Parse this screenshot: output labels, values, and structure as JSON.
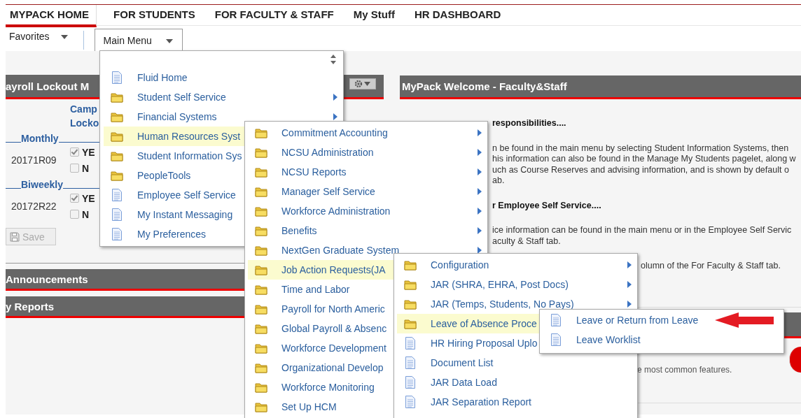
{
  "nav": {
    "tabs": [
      {
        "label": "MYPACK HOME",
        "selected": true
      },
      {
        "label": "FOR STUDENTS",
        "selected": false
      },
      {
        "label": "FOR FACULTY & STAFF",
        "selected": false
      },
      {
        "label": "My Stuff",
        "selected": false
      },
      {
        "label": "HR DASHBOARD",
        "selected": false
      }
    ]
  },
  "toolbar": {
    "favorites": "Favorites",
    "main_menu": "Main Menu"
  },
  "payroll_lockout": {
    "title": "ayroll Lockout M",
    "column_header": [
      "Camp",
      "Locko"
    ],
    "groups": [
      {
        "label": "Monthly",
        "period": "20171R09",
        "options": [
          {
            "label": "YE",
            "checked": true
          },
          {
            "label": "N",
            "checked": false
          }
        ]
      },
      {
        "label": "Biweekly",
        "period": "20172R22",
        "options": [
          {
            "label": "YE",
            "checked": true
          },
          {
            "label": "N",
            "checked": false
          }
        ]
      }
    ],
    "save_button": {
      "label": "Save",
      "disabled": true
    }
  },
  "left_pagelets": [
    {
      "title": "Announcements"
    },
    {
      "title": "y Reports"
    }
  ],
  "welcome": {
    "title": "MyPack Welcome - Faculty&Staff",
    "paragraphs": [
      {
        "kind": "heading",
        "lines": [
          "responsibilities...."
        ]
      },
      {
        "kind": "body",
        "lines": [
          "n be found in the main menu by selecting Student Information Systems, then",
          "his information can also be found in the Manage My Students pagelet, along w",
          "uch as Course Reserves and advising information, and is shown by default o",
          "ab."
        ]
      },
      {
        "kind": "heading",
        "lines": [
          "r Employee Self Service...."
        ]
      },
      {
        "kind": "body",
        "lines": [
          "ice information can be found in the main menu or in the Employee Self Servic",
          "aculty & Staff tab."
        ]
      },
      {
        "kind": "note",
        "lines": [
          "olumn of the For Faculty & Staff tab."
        ]
      }
    ]
  },
  "lower_pagelet": {
    "text": "e most common features."
  },
  "menus": [
    {
      "items": [
        {
          "label": "Fluid Home",
          "kind": "page",
          "submenu": false,
          "selected": false
        },
        {
          "label": "Student Self Service",
          "kind": "folder",
          "submenu": true,
          "selected": false
        },
        {
          "label": "Financial Systems",
          "kind": "folder",
          "submenu": true,
          "selected": false
        },
        {
          "label": "Human Resources Syst",
          "kind": "folder",
          "submenu": false,
          "selected": true
        },
        {
          "label": "Student Information Sys",
          "kind": "folder",
          "submenu": false,
          "selected": false
        },
        {
          "label": "PeopleTools",
          "kind": "folder",
          "submenu": false,
          "selected": false
        },
        {
          "label": "Employee Self Service",
          "kind": "page",
          "submenu": false,
          "selected": false
        },
        {
          "label": "My Instant Messaging",
          "kind": "page",
          "submenu": false,
          "selected": false
        },
        {
          "label": "My Preferences",
          "kind": "page",
          "submenu": false,
          "selected": false
        }
      ]
    },
    {
      "items": [
        {
          "label": "Commitment Accounting",
          "kind": "folder",
          "submenu": true,
          "selected": false
        },
        {
          "label": "NCSU Administration",
          "kind": "folder",
          "submenu": true,
          "selected": false
        },
        {
          "label": "NCSU Reports",
          "kind": "folder",
          "submenu": true,
          "selected": false
        },
        {
          "label": "Manager Self Service",
          "kind": "folder",
          "submenu": true,
          "selected": false
        },
        {
          "label": "Workforce Administration",
          "kind": "folder",
          "submenu": true,
          "selected": false
        },
        {
          "label": "Benefits",
          "kind": "folder",
          "submenu": true,
          "selected": false
        },
        {
          "label": "NextGen Graduate System",
          "kind": "folder",
          "submenu": true,
          "selected": false
        },
        {
          "label": "Job Action Requests(JA",
          "kind": "folder",
          "submenu": false,
          "selected": true
        },
        {
          "label": "Time and Labor",
          "kind": "folder",
          "submenu": false,
          "selected": false
        },
        {
          "label": "Payroll for North Americ",
          "kind": "folder",
          "submenu": false,
          "selected": false
        },
        {
          "label": "Global Payroll & Absenc",
          "kind": "folder",
          "submenu": false,
          "selected": false
        },
        {
          "label": "Workforce Development",
          "kind": "folder",
          "submenu": false,
          "selected": false
        },
        {
          "label": "Organizational Develop",
          "kind": "folder",
          "submenu": false,
          "selected": false
        },
        {
          "label": "Workforce Monitoring",
          "kind": "folder",
          "submenu": false,
          "selected": false
        },
        {
          "label": "Set Up HCM",
          "kind": "folder",
          "submenu": false,
          "selected": false
        }
      ]
    },
    {
      "items": [
        {
          "label": "Configuration",
          "kind": "folder",
          "submenu": true,
          "selected": false
        },
        {
          "label": "JAR (SHRA, EHRA, Post Docs)",
          "kind": "folder",
          "submenu": true,
          "selected": false
        },
        {
          "label": "JAR (Temps, Students, No Pays)",
          "kind": "folder",
          "submenu": true,
          "selected": false
        },
        {
          "label": "Leave of Absence Proce",
          "kind": "folder",
          "submenu": false,
          "selected": true
        },
        {
          "label": "HR Hiring Proposal Uplo",
          "kind": "page",
          "submenu": false,
          "selected": false
        },
        {
          "label": "Document List",
          "kind": "page",
          "submenu": false,
          "selected": false
        },
        {
          "label": "JAR Data Load",
          "kind": "page",
          "submenu": false,
          "selected": false
        },
        {
          "label": "JAR Separation Report",
          "kind": "page",
          "submenu": false,
          "selected": false
        }
      ]
    },
    {
      "items": [
        {
          "label": "Leave or Return from Leave",
          "kind": "page",
          "submenu": false,
          "selected": false
        },
        {
          "label": "Leave Worklist",
          "kind": "page",
          "submenu": false,
          "selected": false
        }
      ]
    }
  ]
}
